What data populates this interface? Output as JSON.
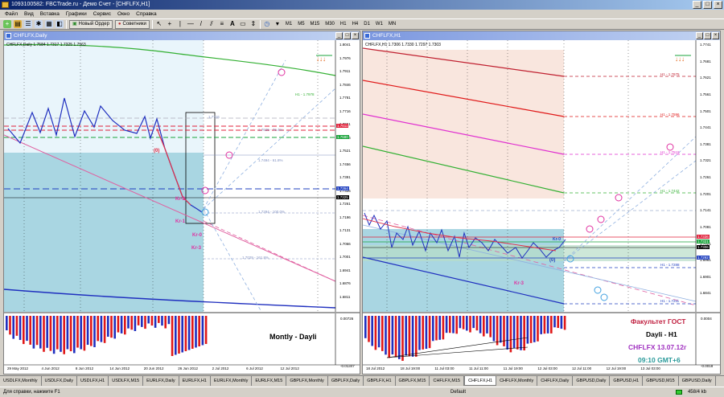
{
  "app": {
    "title": "1093100582: FBCTrade.ru - Демо Счет - [CHFLFX,H1]",
    "menu": [
      "Файл",
      "Вид",
      "Вставка",
      "Графики",
      "Сервис",
      "Окно",
      "Справка"
    ],
    "toolbar": {
      "new_order": "Новый Ордер",
      "advisors": "Советники",
      "timeframes": [
        "M1",
        "M5",
        "M15",
        "M30",
        "H1",
        "H4",
        "D1",
        "W1",
        "MN"
      ]
    }
  },
  "left_chart": {
    "window_title": "CHFLFX,Daily",
    "info_line": "CHFLFX,Daily  1.7584 1.7317 1.7325 1.7563",
    "price_labels": [
      "1.8041",
      "1.7976",
      "1.7911",
      "1.7846",
      "1.7781",
      "1.7716",
      "1.7651",
      "1.7586",
      "1.7521",
      "1.7456",
      "1.7391",
      "1.7326",
      "1.7261",
      "1.7196",
      "1.7131",
      "1.7066",
      "1.7001",
      "1.6941",
      "1.6876",
      "1.6811"
    ],
    "price_badges": [
      {
        "text": "1.7611",
        "color": "#e0203a"
      },
      {
        "text": "1.7580",
        "color": "#1aa33b"
      },
      {
        "text": "1.7364",
        "color": "#2040c0"
      },
      {
        "text": "1.7325",
        "color": "#000000"
      }
    ],
    "date_labels": [
      "29 May 2012",
      "4 Jun 2012",
      "8 Jun 2012",
      "14 Jun 2012",
      "20 Jun 2012",
      "26 Jun 2012",
      "2 Jul 2012",
      "6 Jul 2012",
      "12 Jul 2012"
    ],
    "fib_labels": [
      "1.7716",
      "1.7625 - 76.4%",
      "1.7494 - 61.8%",
      "1.7294 - 100.0%",
      "1.7029 - 161.8%",
      "H1 - 1.7978"
    ],
    "wave_labels": [
      "(0)",
      "Kr-2",
      "Kr-1",
      "Kr-0",
      "Kr-3"
    ],
    "indicator_labels": [
      "0.00726",
      "-0.01347"
    ],
    "annotation": "Montly - Dayli"
  },
  "right_chart": {
    "window_title": "CHFLFX,H1",
    "info_line": "CHFLFX,H1  1.7306 1.7330 1.7297 1.7303",
    "price_labels": [
      "1.7741",
      "1.7681",
      "1.7621",
      "1.7561",
      "1.7501",
      "1.7441",
      "1.7381",
      "1.7321",
      "1.7261",
      "1.7201",
      "1.7141",
      "1.7081",
      "1.7021",
      "1.6961",
      "1.6901",
      "1.6841"
    ],
    "price_badges": [
      {
        "text": "1.7336",
        "color": "#e0203a"
      },
      {
        "text": "1.7321",
        "color": "#1aa33b"
      },
      {
        "text": "1.7306",
        "color": "#000000"
      },
      {
        "text": "1.7292",
        "color": "#2040c0"
      }
    ],
    "level_labels": [
      "H1 - 1.7675",
      "H1 - 1.7596",
      "H1 - 1.7519",
      "H1 - 1.7442",
      "H1 - 1.7288",
      "H1 - 1.7211"
    ],
    "date_labels": [
      "18 Jul 2012",
      "18 Jul 19:00",
      "11 Jul 03:00",
      "11 Jul 11:00",
      "11 Jul 19:00",
      "12 Jul 03:00",
      "12 Jul 11:00",
      "12 Jul 19:00",
      "13 Jul 03:00"
    ],
    "wave_labels": [
      "Kr-3",
      "(0)",
      "Kr-0"
    ],
    "indicator_labels": [
      "0.0004",
      "-0.0018"
    ],
    "notes": {
      "line1": "Факультет ГОСТ",
      "line2": "Dayli - H1",
      "line3": "CHFLFX 13.07.12г",
      "line4": "09:10 GMT+6"
    }
  },
  "tabs": [
    "USDLFX,Monthly",
    "USDLFX,Daily",
    "USDLFX,H1",
    "USDLFX,M15",
    "EURLFX,Daily",
    "EURLFX,H1",
    "EURLFX,Monthly",
    "EURLFX,M15",
    "GBPLFX,Monthly",
    "GBPLFX,Daily",
    "GBPLFX,H1",
    "GBPLFX,M15",
    "CHFLFX,M15",
    "CHFLFX,H1",
    "CHFLFX,Monthly",
    "CHFLFX,Daily",
    "GBPUSD,Daily",
    "GBPUSD,H1",
    "GBPUSD,M15",
    "GBPUSD,Daily"
  ],
  "active_tab": "CHFLFX,H1",
  "status": {
    "left": "Для справки, нажмите F1",
    "middle": "Default",
    "right": "458/4 kb"
  },
  "colors": {
    "ask_blue": "#1f2fbf",
    "bid_red": "#e01818",
    "fibo_pink": "#e030a0",
    "ma_green": "#33b033",
    "zone_blue": "#a9d6e2"
  }
}
